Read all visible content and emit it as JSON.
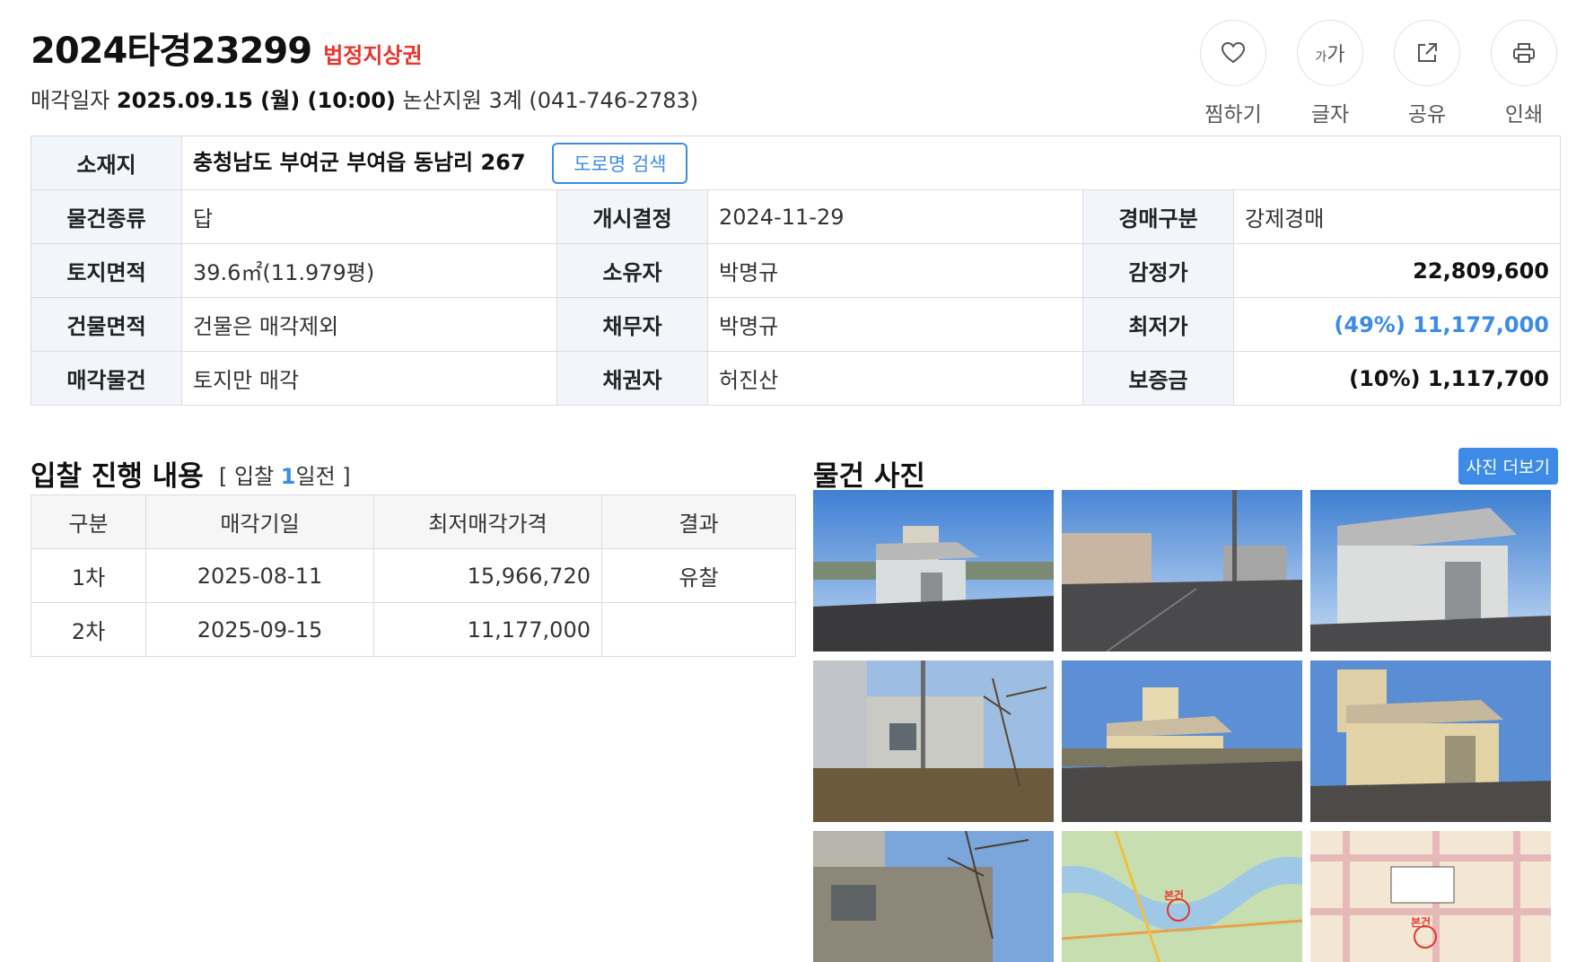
{
  "header": {
    "case_no": "2024타경23299",
    "case_tag": "법정지상권",
    "sale_date_label": "매각일자",
    "sale_date": "2025.09.15 (월) (10:00)",
    "court": "논산지원 3계 (041-746-2783)"
  },
  "actions": [
    {
      "label": "찜하기",
      "icon": "heart-icon"
    },
    {
      "label": "글자",
      "icon": "font-size-icon",
      "glyph_small": "가",
      "glyph_big": "가"
    },
    {
      "label": "공유",
      "icon": "share-icon"
    },
    {
      "label": "인쇄",
      "icon": "print-icon"
    }
  ],
  "info": {
    "location_label": "소재지",
    "location": "충청남도 부여군 부여읍 동남리 267",
    "road_search": "도로명 검색",
    "rows": [
      [
        {
          "h": "물건종류",
          "v": "답"
        },
        {
          "h": "개시결정",
          "v": "2024-11-29"
        },
        {
          "h": "경매구분",
          "v": "강제경매"
        }
      ],
      [
        {
          "h": "토지면적",
          "v": "39.6㎡(11.979평)"
        },
        {
          "h": "소유자",
          "v": "박명규"
        },
        {
          "h": "감정가",
          "v": "22,809,600"
        }
      ],
      [
        {
          "h": "건물면적",
          "v": "건물은 매각제외"
        },
        {
          "h": "채무자",
          "v": "박명규"
        },
        {
          "h": "최저가",
          "v": "(49%) 11,177,000"
        }
      ],
      [
        {
          "h": "매각물건",
          "v": "토지만 매각"
        },
        {
          "h": "채권자",
          "v": "허진산"
        },
        {
          "h": "보증금",
          "v": "(10%) 1,117,700"
        }
      ]
    ]
  },
  "bid": {
    "title": "입찰 진행 내용",
    "sub_prefix": "[ 입찰 ",
    "sub_days": "1",
    "sub_suffix": "일전 ]",
    "headers": [
      "구분",
      "매각기일",
      "최저매각가격",
      "결과"
    ],
    "rows": [
      [
        "1차",
        "2025-08-11",
        "15,966,720",
        "유찰"
      ],
      [
        "2차",
        "2025-09-15",
        "11,177,000",
        ""
      ]
    ]
  },
  "photos": {
    "title": "물건 사진",
    "more": "사진 더보기",
    "map_label": "본건"
  },
  "colors": {
    "accent": "#3d8be6",
    "alert": "#e8352d",
    "header_bg": "#f2f5f9",
    "border": "#dcdcdc"
  }
}
